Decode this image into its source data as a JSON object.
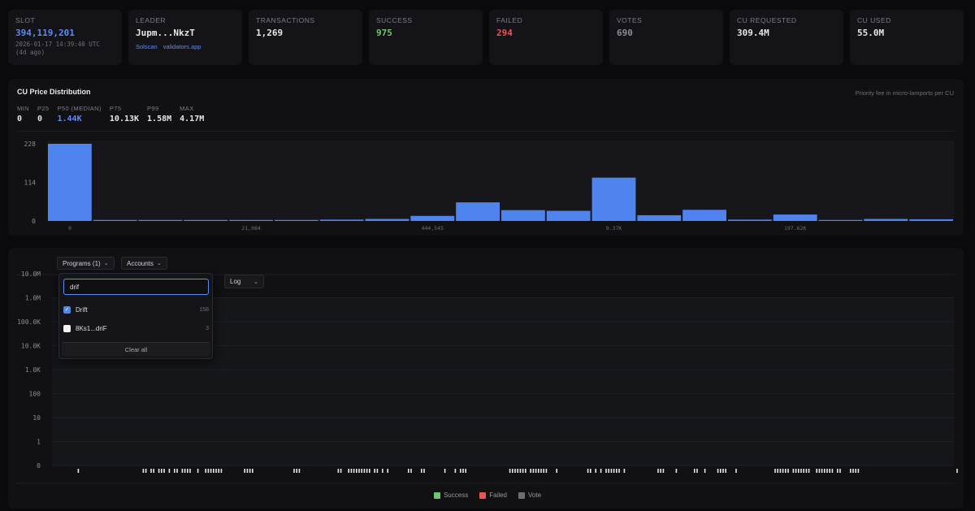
{
  "stats": {
    "slot": {
      "label": "SLOT",
      "value": "394,119,201",
      "time": "2026-01-17 14:39:40 UTC",
      "ago": "(4d ago)"
    },
    "leader": {
      "label": "LEADER",
      "value": "Jupm...NkzT",
      "link1": "Solscan",
      "link2": "validators.app"
    },
    "transactions": {
      "label": "TRANSACTIONS",
      "value": "1,269"
    },
    "success": {
      "label": "SUCCESS",
      "value": "975"
    },
    "failed": {
      "label": "FAILED",
      "value": "294"
    },
    "votes": {
      "label": "VOTES",
      "value": "690"
    },
    "cu_requested": {
      "label": "CU REQUESTED",
      "value": "309.4M"
    },
    "cu_used": {
      "label": "CU USED",
      "value": "55.0M"
    }
  },
  "colors": {
    "accent": "#5b8def",
    "success": "#6cc86c",
    "failed": "#e8564f",
    "vote": "#6a6f78",
    "bar": "#4f84ee",
    "failed_bar": "#e39a94",
    "success_bar": "#7fcc85"
  },
  "cu_panel": {
    "title": "CU Price Distribution",
    "note": "Priority fee in micro-lamports per CU",
    "percentiles": [
      {
        "label": "MIN",
        "value": "0"
      },
      {
        "label": "P25",
        "value": "0"
      },
      {
        "label": "P50 (MEDIAN)",
        "value": "1.44K"
      },
      {
        "label": "P75",
        "value": "10.13K"
      },
      {
        "label": "P99",
        "value": "1.58M"
      },
      {
        "label": "MAX",
        "value": "4.17M"
      }
    ]
  },
  "chart_data": [
    {
      "type": "bar",
      "title": "CU Price Distribution",
      "values": [
        228,
        3,
        3,
        3,
        3,
        3,
        4,
        6,
        15,
        55,
        32,
        30,
        128,
        17,
        33,
        4,
        19,
        3,
        6,
        5
      ],
      "ylim": [
        0,
        228
      ],
      "yticks": [
        "228",
        "114",
        "0"
      ],
      "xtick_labels": [
        {
          "bin": 0,
          "label": "0"
        },
        {
          "bin": 4,
          "label": "21,084"
        },
        {
          "bin": 8,
          "label": "444,545"
        },
        {
          "bin": 12,
          "label": "9.37K"
        },
        {
          "bin": 16,
          "label": "197.62K"
        }
      ]
    },
    {
      "type": "bar",
      "title": "",
      "yscale": "log",
      "yticks": [
        "10.0M",
        "1.0M",
        "100.0K",
        "10.0K",
        "1.0K",
        "100",
        "10",
        "1",
        "0"
      ],
      "legend": [
        {
          "name": "Success",
          "color": "#6cc86c"
        },
        {
          "name": "Failed",
          "color": "#e8564f"
        },
        {
          "name": "Vote",
          "color": "#6a6f78"
        }
      ],
      "legend_position": "bottom-center"
    }
  ],
  "tx_panel": {
    "programs_label": "Programs (1)",
    "accounts_label": "Accounts",
    "scale_label": "Log",
    "search_value": "drif",
    "options": [
      {
        "label": "Drift",
        "count": "158",
        "checked": true
      },
      {
        "label": "8Ks1...driF",
        "count": "3",
        "checked": false
      }
    ],
    "clear_label": "Clear all"
  }
}
